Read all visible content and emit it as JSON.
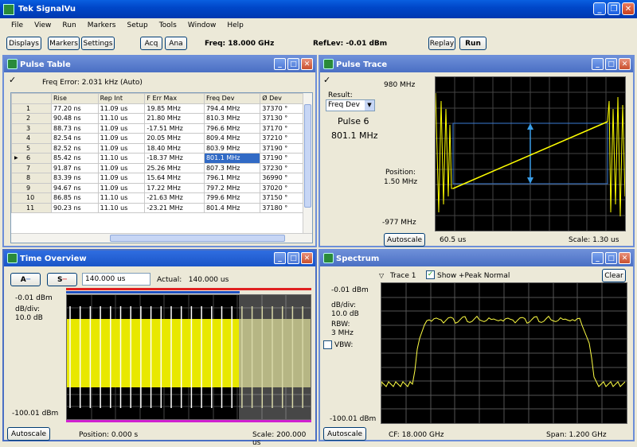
{
  "app": {
    "title": "Tek SignalVu"
  },
  "menu": [
    "File",
    "View",
    "Run",
    "Markers",
    "Setup",
    "Tools",
    "Window",
    "Help"
  ],
  "toolbar": {
    "displays": "Displays",
    "markers": "Markers",
    "settings": "Settings",
    "acq": "Acq",
    "ana": "Ana",
    "freq": "Freq: 18.000 GHz",
    "reflev": "RefLev: -0.01 dBm",
    "replay": "Replay",
    "run": "Run"
  },
  "pulse_table": {
    "title": "Pulse Table",
    "freq_error": "Freq Error: 2.031 kHz (Auto)",
    "columns": [
      "",
      "Rise",
      "Rep Int",
      "F Err Max",
      "Freq Dev",
      "Ø Dev"
    ],
    "rows": [
      [
        "1",
        "77.20 ns",
        "11.09 us",
        "19.85 MHz",
        "794.4 MHz",
        "37370 °"
      ],
      [
        "2",
        "90.48 ns",
        "11.10 us",
        "21.80 MHz",
        "810.3 MHz",
        "37130 °"
      ],
      [
        "3",
        "88.73 ns",
        "11.09 us",
        "-17.51 MHz",
        "796.6 MHz",
        "37170 °"
      ],
      [
        "4",
        "82.54 ns",
        "11.09 us",
        "20.05 MHz",
        "809.4 MHz",
        "37210 °"
      ],
      [
        "5",
        "82.52 ns",
        "11.09 us",
        "18.40 MHz",
        "803.9 MHz",
        "37190 °"
      ],
      [
        "6",
        "85.42 ns",
        "11.10 us",
        "-18.37 MHz",
        "801.1 MHz",
        "37190 °"
      ],
      [
        "7",
        "91.87 ns",
        "11.09 us",
        "25.26 MHz",
        "807.3 MHz",
        "37230 °"
      ],
      [
        "8",
        "83.39 ns",
        "11.09 us",
        "15.64 MHz",
        "796.1 MHz",
        "36990 °"
      ],
      [
        "9",
        "94.67 ns",
        "11.09 us",
        "17.22 MHz",
        "797.2 MHz",
        "37020 °"
      ],
      [
        "10",
        "86.85 ns",
        "11.10 us",
        "-21.63 MHz",
        "799.6 MHz",
        "37150 °"
      ],
      [
        "11",
        "90.23 ns",
        "11.10 us",
        "-23.21 MHz",
        "801.4 MHz",
        "37180 °"
      ]
    ]
  },
  "pulse_trace": {
    "title": "Pulse Trace",
    "top": "980 MHz",
    "result_label": "Result:",
    "result_value": "Freq Dev",
    "pulse": "Pulse 6",
    "pulse_freq": "801.1 MHz",
    "position_label": "Position:",
    "position_value": "1.50 MHz",
    "bottom": "-977 MHz",
    "autoscale": "Autoscale",
    "time": "60.5 us",
    "scale": "Scale: 1.30 us"
  },
  "time_overview": {
    "title": "Time Overview",
    "time_input": "140.000 us",
    "actual": "Actual:   140.000 us",
    "ref": "-0.01 dBm",
    "dbdiv_label": "dB/div:",
    "dbdiv": "10.0 dB",
    "bottom": "-100.01 dBm",
    "autoscale": "Autoscale",
    "position": "Position: 0.000 s",
    "scale": "Scale: 200.000 us"
  },
  "spectrum": {
    "title": "Spectrum",
    "trace": "Trace 1",
    "show": "Show",
    "peak": "+Peak Normal",
    "clear": "Clear",
    "ref": "-0.01 dBm",
    "dbdiv_label": "dB/div:",
    "dbdiv": "10.0 dB",
    "rbw_label": "RBW:",
    "rbw": "3 MHz",
    "vbw": "VBW:",
    "bottom": "-100.01 dBm",
    "autoscale": "Autoscale",
    "cf": "CF: 18.000 GHz",
    "span": "Span: 1.200 GHz"
  }
}
